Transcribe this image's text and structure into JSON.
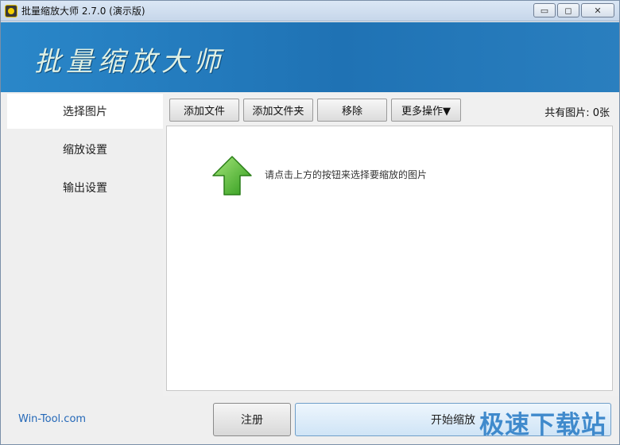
{
  "window": {
    "title": "批量缩放大师 2.7.0 (演示版)",
    "icon": "app-logo-icon",
    "controls": {
      "minimize": "▭",
      "maximize": "◻",
      "close": "✕"
    }
  },
  "banner": {
    "title": "批量缩放大师"
  },
  "sidebar": {
    "items": [
      {
        "label": "选择图片",
        "active": true
      },
      {
        "label": "缩放设置",
        "active": false
      },
      {
        "label": "输出设置",
        "active": false
      }
    ]
  },
  "toolbar": {
    "add_file": "添加文件",
    "add_folder": "添加文件夹",
    "remove": "移除",
    "more": "更多操作▼",
    "count": "共有图片: 0张"
  },
  "filearea": {
    "hint": "请点击上方的按钮来选择要缩放的图片",
    "icon": "upload-arrow-icon"
  },
  "footer": {
    "link": "Win-Tool.com",
    "register": "注册",
    "start": "开始缩放",
    "watermark": "极速下载站"
  },
  "colors": {
    "banner": "#1f72b4",
    "arrow": "#4cb82a",
    "link": "#2468b8",
    "watermark": "#2f80c8"
  }
}
